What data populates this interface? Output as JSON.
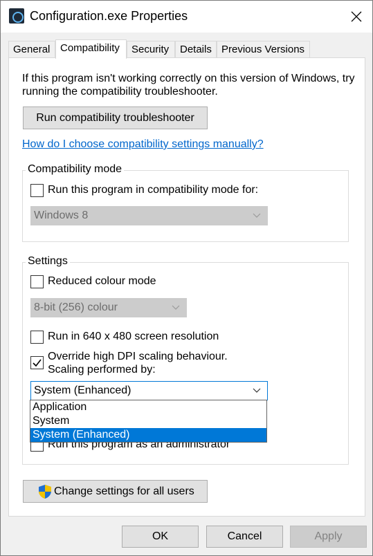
{
  "window": {
    "title": "Configuration.exe Properties"
  },
  "tabs": [
    {
      "label": "General"
    },
    {
      "label": "Compatibility"
    },
    {
      "label": "Security"
    },
    {
      "label": "Details"
    },
    {
      "label": "Previous Versions"
    }
  ],
  "active_tab": "Compatibility",
  "intro": {
    "line1": "If this program isn't working correctly on this version of Windows, try",
    "line2": "running the compatibility troubleshooter."
  },
  "troubleshooter_button": "Run compatibility troubleshooter",
  "help_link": "How do I choose compatibility settings manually?",
  "compat_mode": {
    "group_label": "Compatibility mode",
    "checkbox_label": "Run this program in compatibility mode for:",
    "checked": false,
    "os_select_value": "Windows 8"
  },
  "settings": {
    "group_label": "Settings",
    "reduced_colour": {
      "label": "Reduced colour mode",
      "checked": false
    },
    "colour_select_value": "8-bit (256) colour",
    "run_640": {
      "label": "Run in 640 x 480 screen resolution",
      "checked": false
    },
    "override_dpi": {
      "label_line1": "Override high DPI scaling behaviour.",
      "label_line2": "Scaling performed by:",
      "checked": true
    },
    "dpi_select_value": "System (Enhanced)",
    "dpi_options": [
      "Application",
      "System",
      "System (Enhanced)"
    ],
    "dpi_selected_option": "System (Enhanced)",
    "run_admin": {
      "label": "Run this program as an administrator",
      "checked": false
    }
  },
  "change_all_users_button": "Change settings for all users",
  "footer": {
    "ok": "OK",
    "cancel": "Cancel",
    "apply": "Apply"
  },
  "colors": {
    "accent": "#0078d7",
    "link": "#0066cc",
    "shield_blue": "#1f6fd1",
    "shield_yellow": "#f2c200"
  },
  "icons": {
    "app": "app-icon",
    "close": "close-icon",
    "shield": "uac-shield-icon",
    "chevron": "chevron-down-icon",
    "checkmark": "checkmark-icon"
  }
}
